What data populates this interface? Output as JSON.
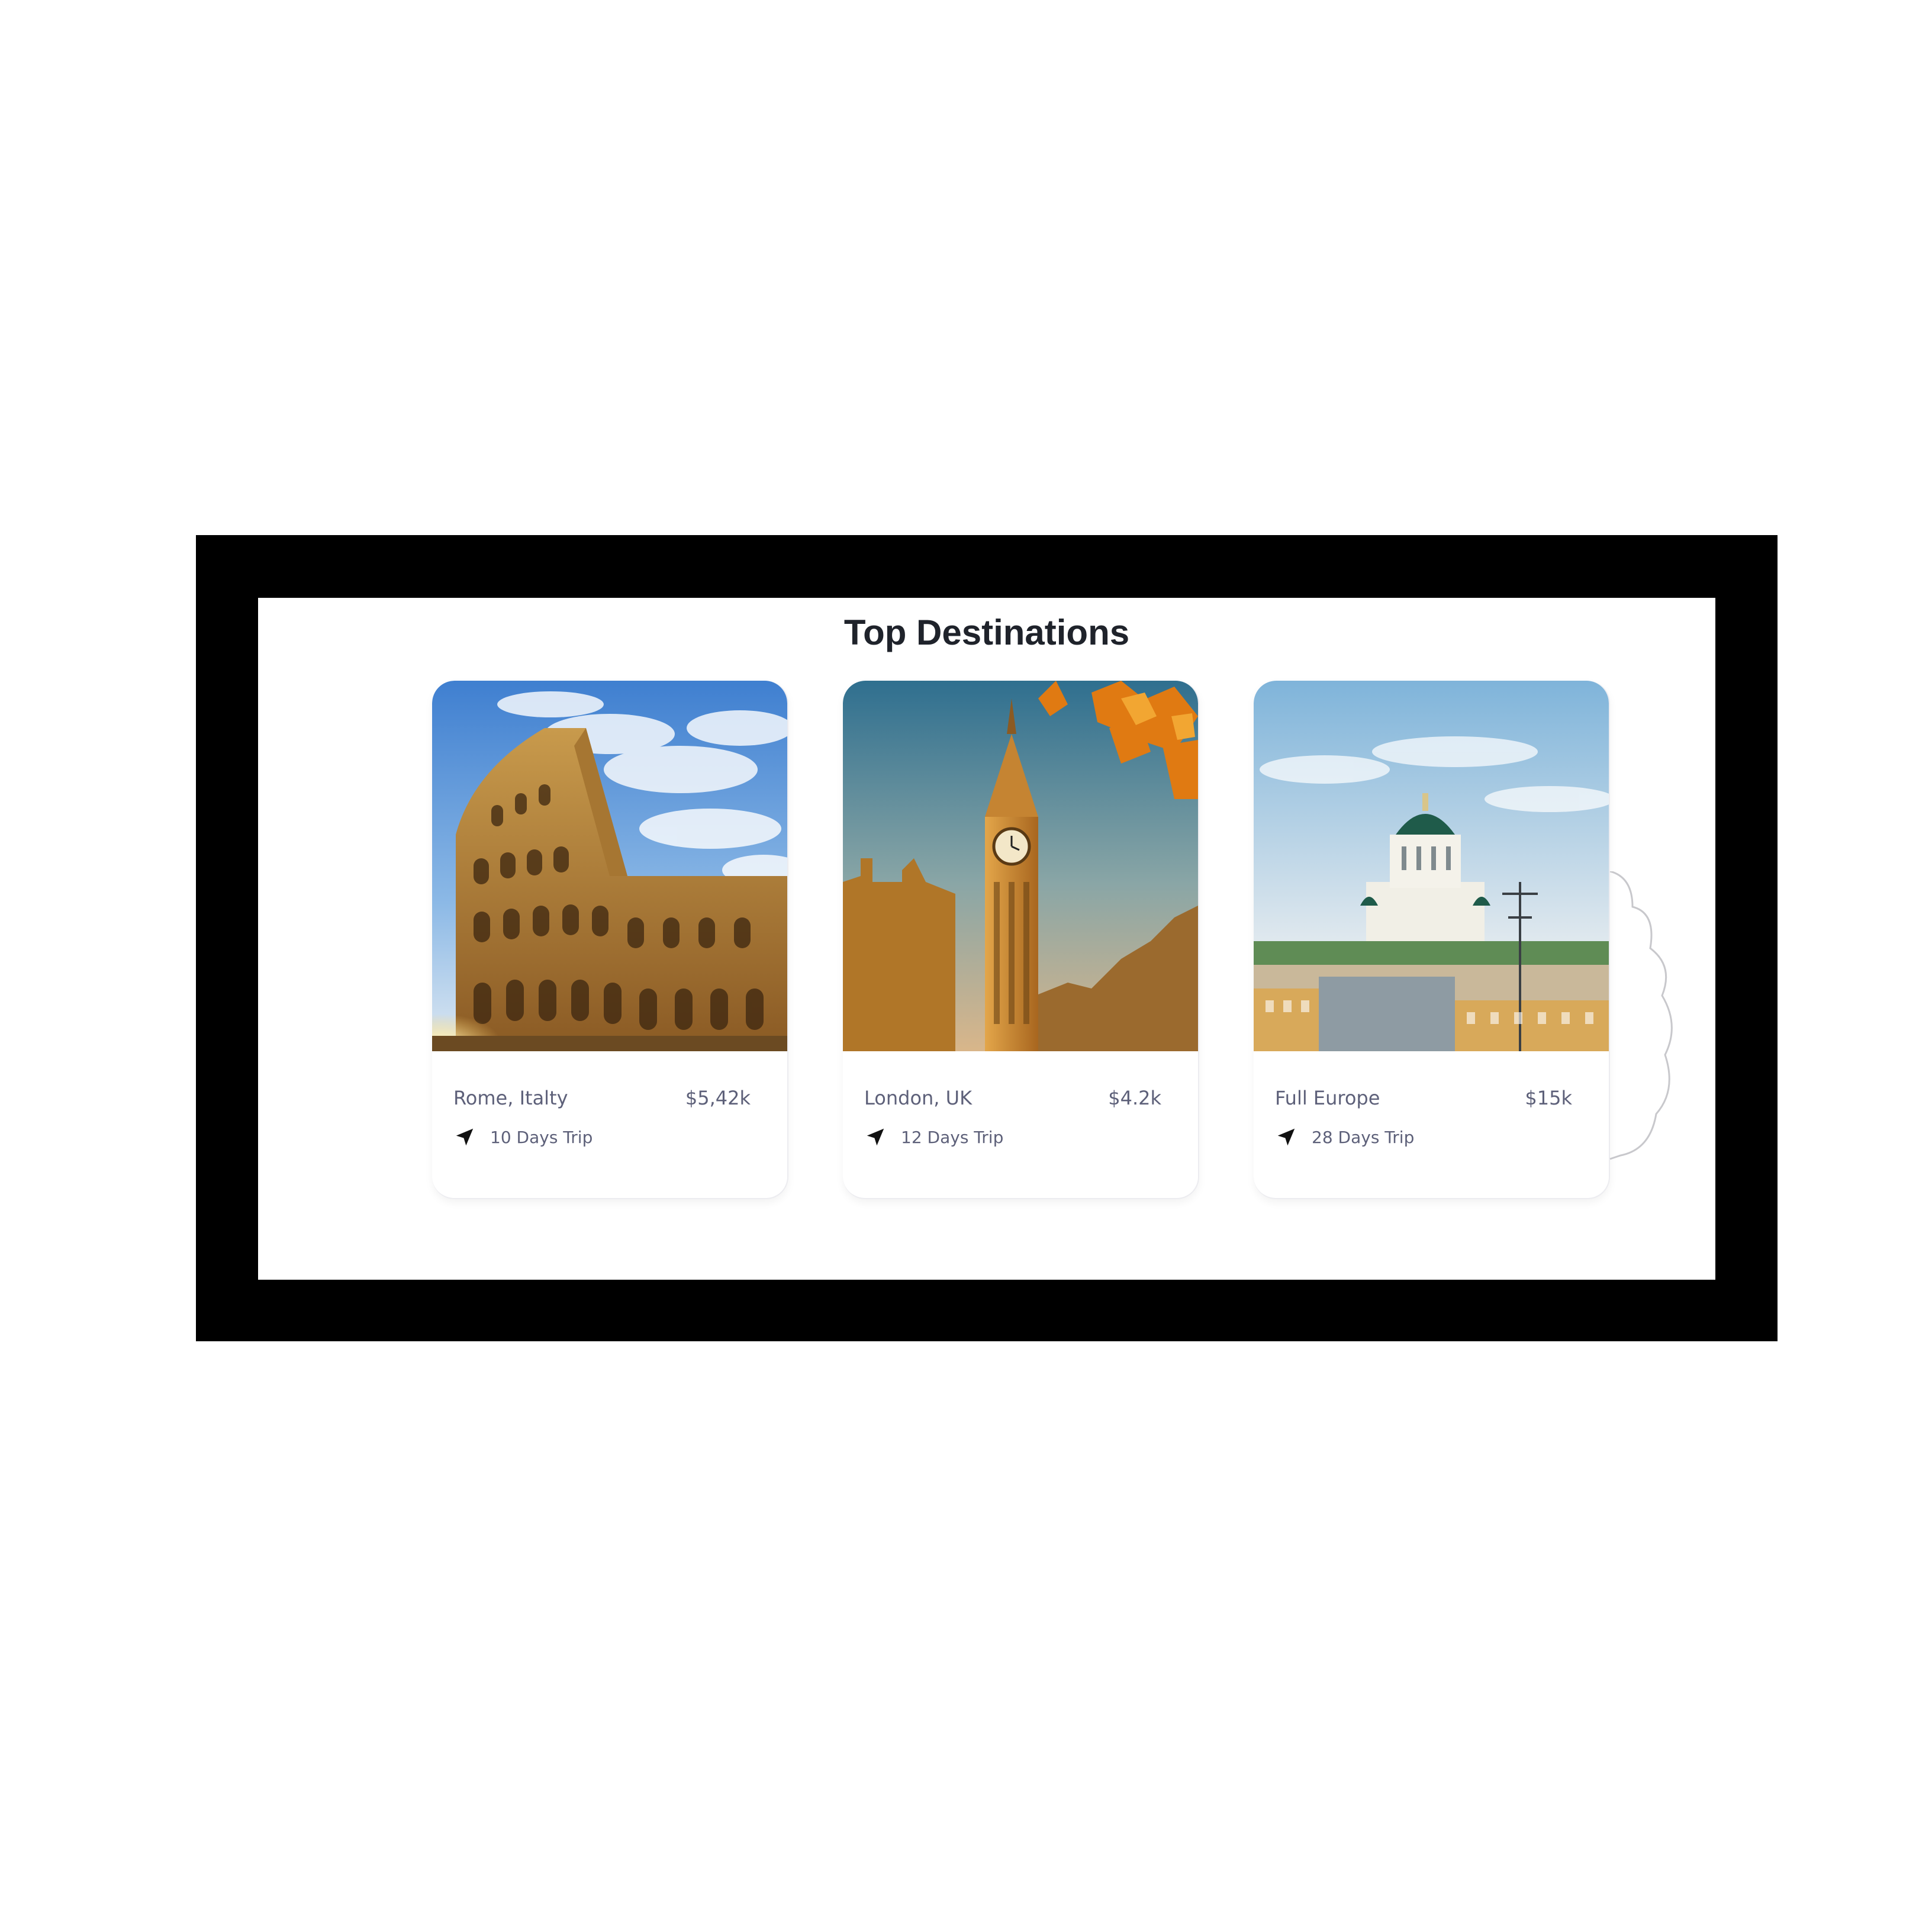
{
  "section": {
    "title": "Top Destinations"
  },
  "destinations": [
    {
      "name": "Rome, Italty",
      "price": "$5,42k",
      "trip": "10 Days Trip",
      "image": "colosseum-photo"
    },
    {
      "name": "London, UK",
      "price": "$4.2k",
      "trip": "12 Days Trip",
      "image": "big-ben-photo"
    },
    {
      "name": "Full Europe",
      "price": "$15k",
      "trip": "28 Days Trip",
      "image": "helsinki-cathedral-photo"
    }
  ],
  "colors": {
    "frame": "#000000",
    "title": "#1f232b",
    "card_text": "#5d6079"
  }
}
